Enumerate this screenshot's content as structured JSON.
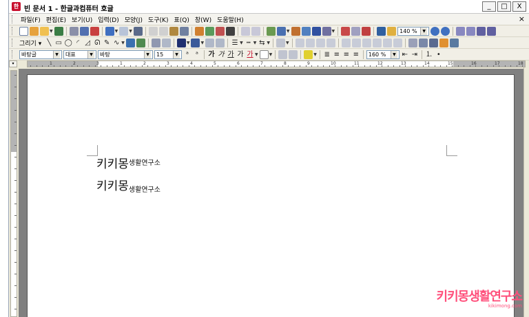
{
  "window": {
    "title": "빈 문서 1 - 한글과컴퓨터 호글",
    "controls": {
      "minimize": "_",
      "maximize": "□",
      "close": "X"
    }
  },
  "menu": {
    "items": [
      "파일(F)",
      "편집(E)",
      "보기(U)",
      "입력(D)",
      "모양(J)",
      "도구(K)",
      "표(Q)",
      "창(W)",
      "도움말(H)"
    ],
    "close": "×"
  },
  "toolbar": {
    "zoom": "140 %",
    "draw_label": "그리기 ▾",
    "style": "바탕글",
    "text_kind": "대표",
    "font": "바탕",
    "font_size": "15",
    "line_spacing": "160 %",
    "text_glyphs": [
      "가",
      "가",
      "가",
      "가",
      "가"
    ]
  },
  "ruler": {
    "numbers": [
      "1",
      "2",
      "3",
      "1",
      "2",
      "3",
      "4",
      "5",
      "6",
      "7",
      "8",
      "9",
      "10",
      "11",
      "12",
      "13",
      "14",
      "15",
      "16",
      "17",
      "18"
    ]
  },
  "document": {
    "line1_main": "키키몽",
    "line1_sup": "생활연구소",
    "line2_main": "키키몽",
    "line2_sub": "생활연구소"
  },
  "watermark": {
    "logo": "키키몽생활연구소",
    "url": "kikimong.com"
  },
  "colors": {
    "accent": "#c8102e",
    "watermark": "#ff4f7b",
    "workspace": "#808080"
  }
}
